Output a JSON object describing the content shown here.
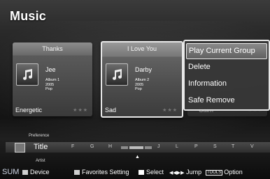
{
  "app": {
    "title": "Music"
  },
  "cards": [
    {
      "group": "Thanks",
      "artist": "Jee",
      "album": "Album 1",
      "year": "2005",
      "genre": "Pop",
      "mood": "Energetic",
      "stars": "★★★"
    },
    {
      "group": "I Love You",
      "artist": "Darby",
      "album": "Album 2",
      "year": "2005",
      "genre": "Pop",
      "mood": "Sad",
      "stars": "★★★"
    },
    {
      "mood": "Calm",
      "stars": "★★★"
    }
  ],
  "menu": {
    "items": [
      "Play Current Group",
      "Delete",
      "Information",
      "Safe Remove"
    ],
    "selected_index": 0
  },
  "sort": {
    "label_above": "Preference",
    "current": "Title",
    "label_below": "Artist",
    "letters": [
      "F",
      "G",
      "H",
      "J",
      "L",
      "P",
      "S",
      "T",
      "V"
    ]
  },
  "help": {
    "sum": "SUM",
    "device": "Device",
    "favorites": "Favorites Setting",
    "select": "Select",
    "jump": "Jump",
    "tools": "TOOLS",
    "option": "Option"
  },
  "colors": {
    "selection_border": "#e8e8e8",
    "menu_bg": "#373737"
  },
  "icons": [
    "music-note-icon",
    "sort-icon",
    "rewind-icon",
    "fast-forward-icon",
    "caret-up-icon"
  ]
}
